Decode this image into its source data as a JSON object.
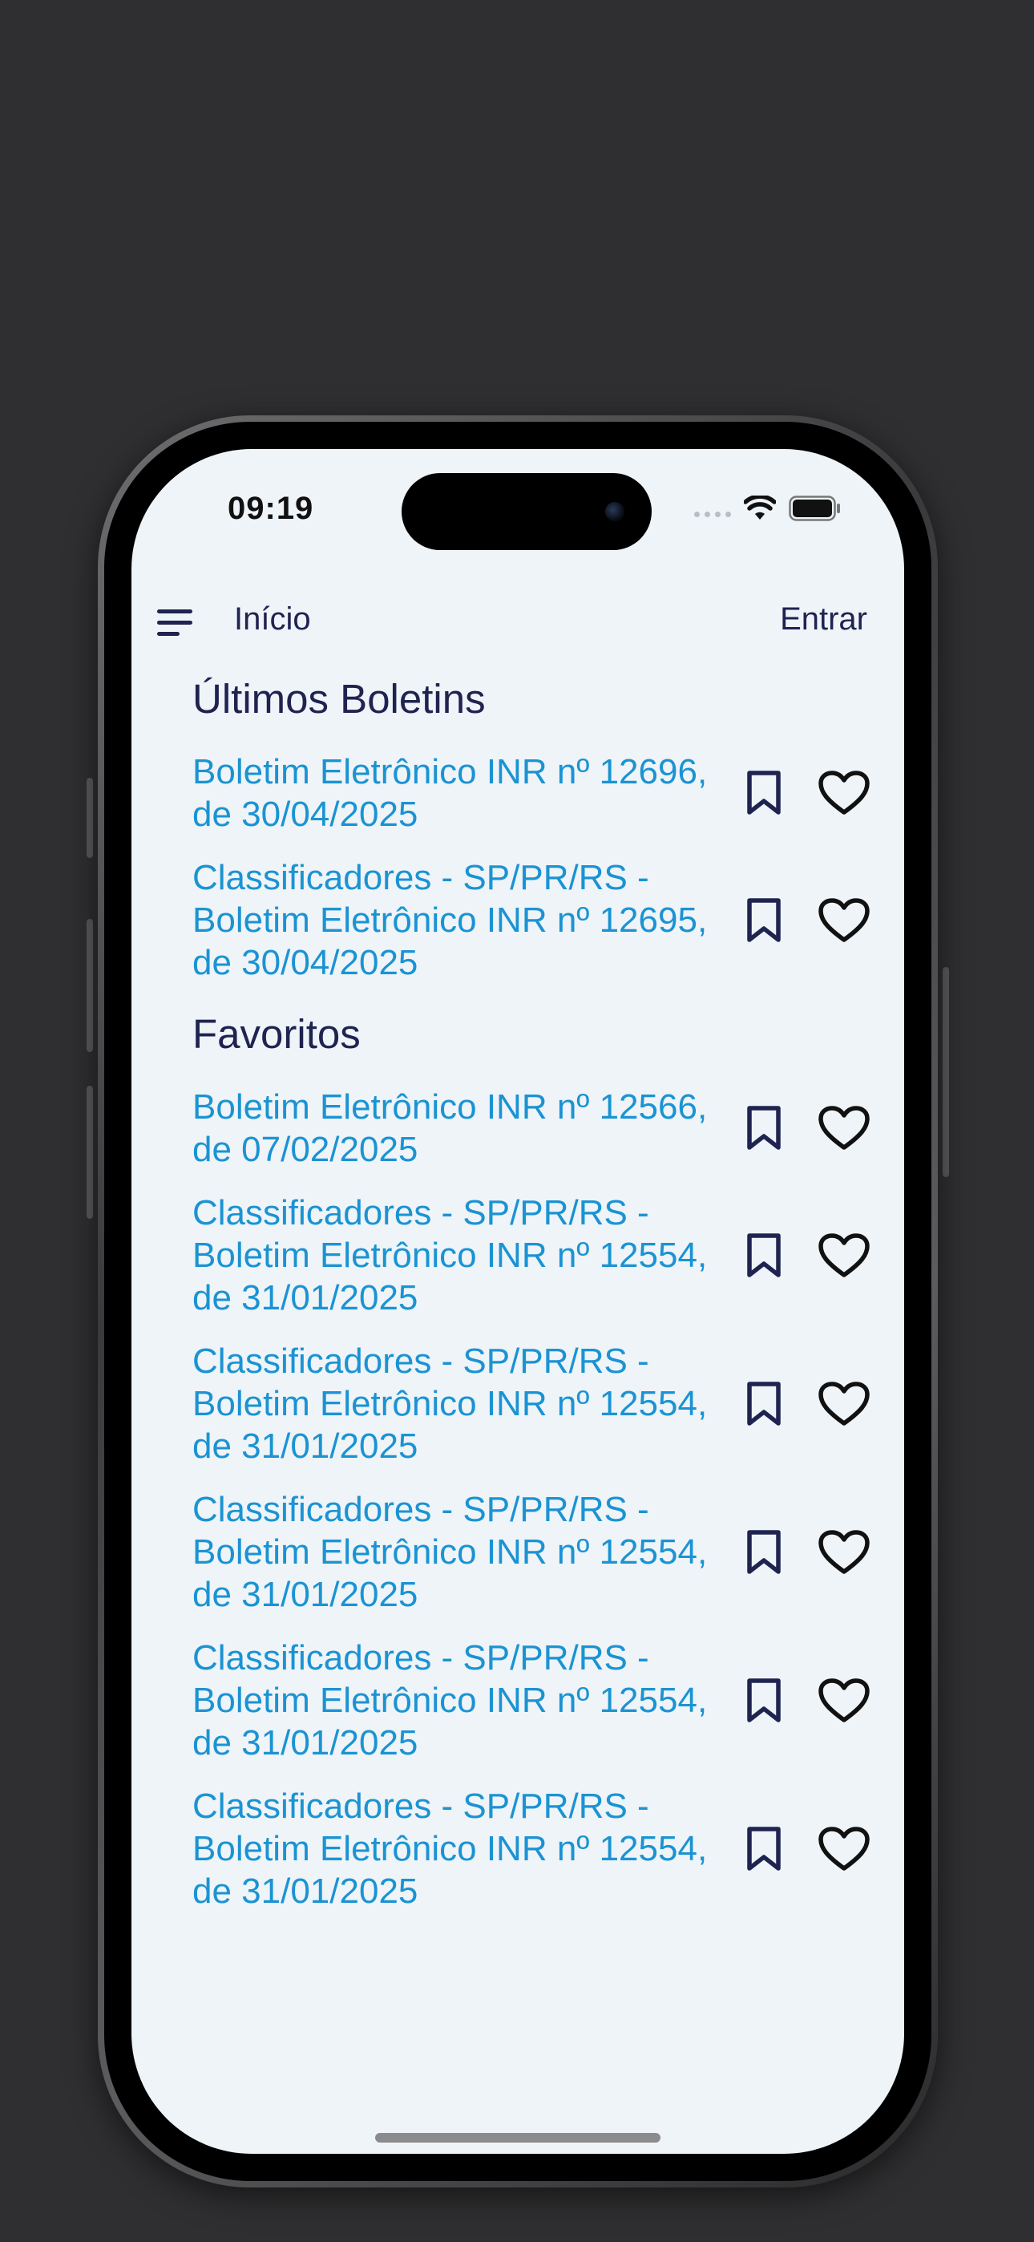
{
  "status_bar": {
    "time": "09:19"
  },
  "app_bar": {
    "title": "Início",
    "login_label": "Entrar"
  },
  "sections": [
    {
      "title": "Últimos Boletins",
      "items": [
        {
          "lines": [
            "Boletim Eletrônico INR nº 12696,",
            "de 30/04/2025"
          ]
        },
        {
          "lines": [
            "Classificadores - SP/PR/RS -",
            "Boletim Eletrônico INR nº 12695,",
            "de 30/04/2025"
          ]
        }
      ]
    },
    {
      "title": "Favoritos",
      "items": [
        {
          "lines": [
            "Boletim Eletrônico INR nº 12566,",
            "de 07/02/2025"
          ]
        },
        {
          "lines": [
            "Classificadores - SP/PR/RS -",
            "Boletim Eletrônico INR nº 12554,",
            "de 31/01/2025"
          ]
        },
        {
          "lines": [
            "Classificadores - SP/PR/RS -",
            "Boletim Eletrônico INR nº 12554,",
            "de 31/01/2025"
          ]
        },
        {
          "lines": [
            "Classificadores - SP/PR/RS -",
            "Boletim Eletrônico INR nº 12554,",
            "de 31/01/2025"
          ]
        },
        {
          "lines": [
            "Classificadores - SP/PR/RS -",
            "Boletim Eletrônico INR nº 12554,",
            "de 31/01/2025"
          ]
        },
        {
          "lines": [
            "Classificadores - SP/PR/RS -",
            "Boletim Eletrônico INR nº 12554,",
            "de 31/01/2025"
          ]
        }
      ]
    }
  ],
  "icons": {
    "menu": "menu-icon",
    "bookmark": "bookmark-icon",
    "favorite": "heart-icon",
    "wifi": "wifi-icon",
    "battery": "battery-icon",
    "signal": "cellular-signal-icon"
  },
  "colors": {
    "background": "#2f2f31",
    "screen": "#eef4f8",
    "primary_text": "#1f2350",
    "link": "#1b93d3"
  }
}
